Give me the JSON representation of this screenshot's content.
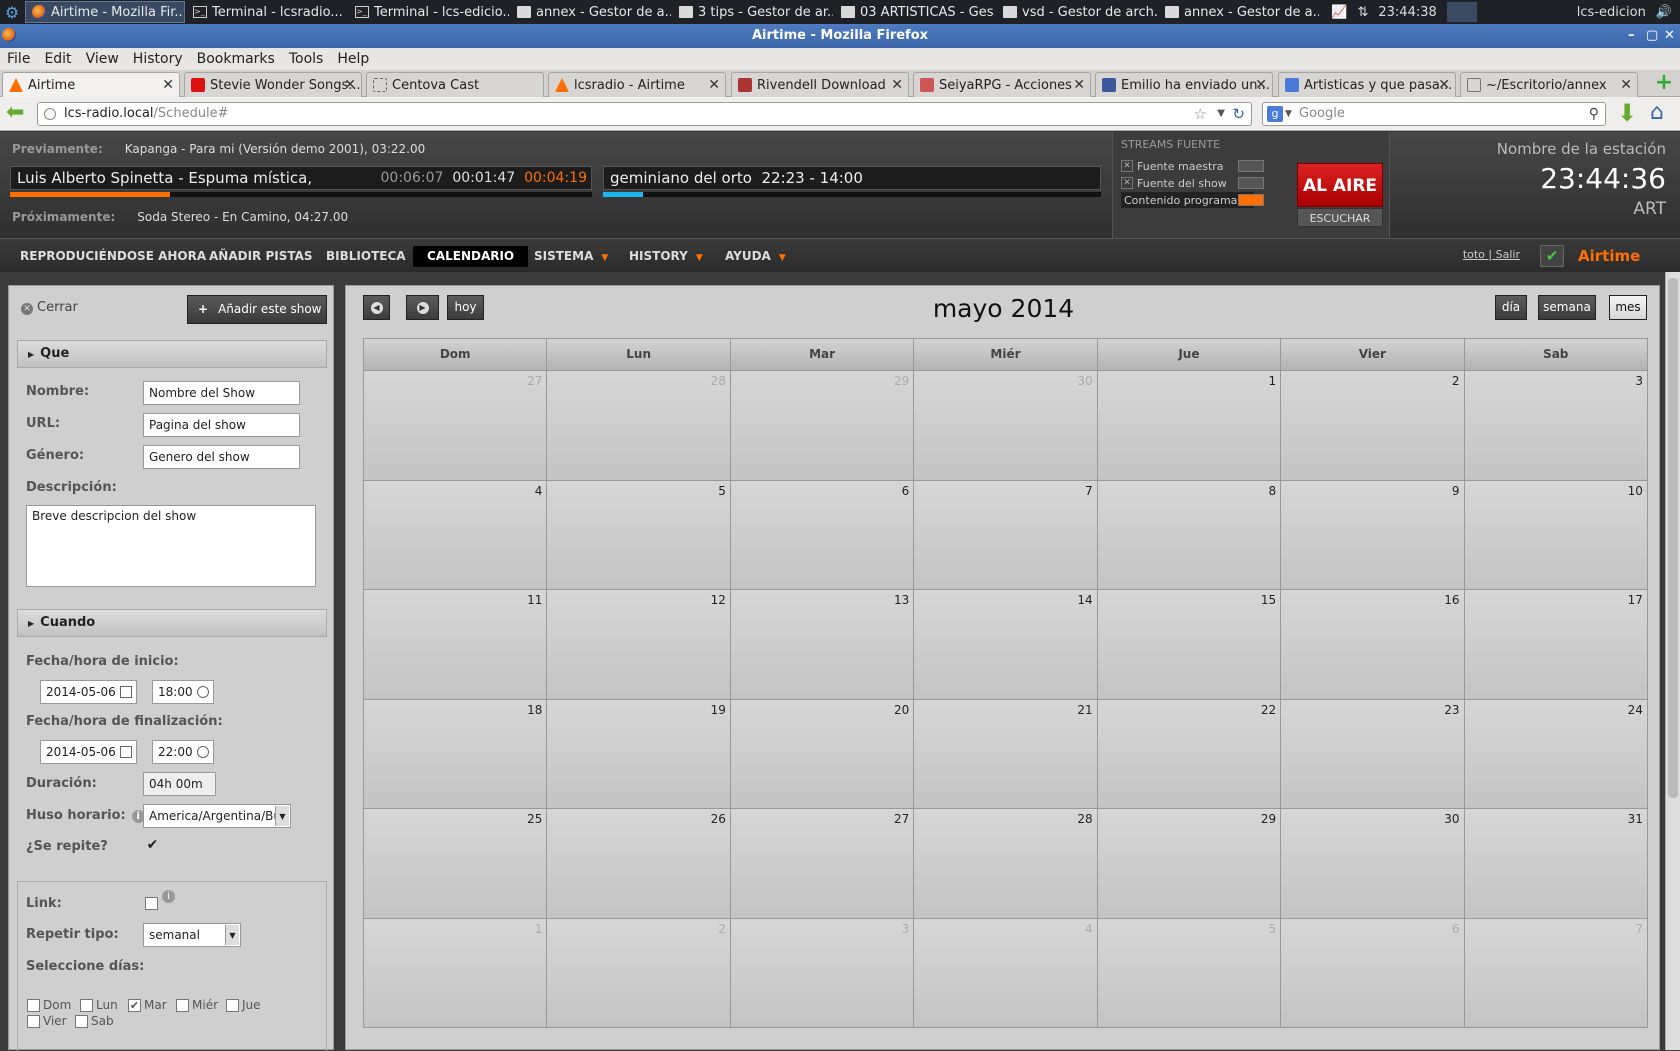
{
  "taskbar": {
    "tasks": [
      "Airtime - Mozilla Fir...",
      "Terminal - lcsradio...",
      "Terminal - lcs-edicio...",
      "annex - Gestor de a...",
      "3 tips - Gestor de ar...",
      "03 ARTISTICAS - Ges...",
      "vsd - Gestor de arch...",
      "annex - Gestor de a..."
    ],
    "clock": "23:44:38",
    "user": "lcs-edicion"
  },
  "window": {
    "title": "Airtime - Mozilla Firefox"
  },
  "menu": [
    "File",
    "Edit",
    "View",
    "History",
    "Bookmarks",
    "Tools",
    "Help"
  ],
  "tabs": [
    "Airtime",
    "Stevie Wonder Songs...",
    "Centova Cast",
    "lcsradio - Airtime",
    "Rivendell Download",
    "SeiyaRPG - Acciones",
    "Emilio ha enviado un...",
    "Artisticas y que pasa...",
    "~/Escritorio/annex"
  ],
  "nav": {
    "url_host": "lcs-radio.local",
    "url_path": "/Schedule#",
    "search_placeholder": "Google"
  },
  "player": {
    "prev_label": "Previamente:",
    "prev_value": "Kapanga - Para mi (Versión demo 2001), 03:22.00",
    "current_track": "Luis Alberto Spinetta - Espuma mística,",
    "elapsed": "00:06:07",
    "middle": "00:01:47",
    "remaining": "00:04:19",
    "track_progress": 0.275,
    "current_show": "geminiano del orto",
    "show_time": "22:23 - 14:00",
    "show_progress": 0.08,
    "next_label": "Próximamente:",
    "next_value": "Soda Stereo - En Camino, 04:27.00"
  },
  "streams": {
    "title": "STREAMS FUENTE",
    "master": "Fuente maestra",
    "show": "Fuente del show",
    "scheduled": "Contenido programado",
    "on_air": "AL AIRE",
    "listen": "ESCUCHAR"
  },
  "station": {
    "name": "Nombre de la estación",
    "clock": "23:44:36",
    "tz": "ART"
  },
  "mainnav": {
    "items": [
      "REPRODUCIÉNDOSE AHORA",
      "AÑADIR PISTAS",
      "BIBLIOTECA",
      "CALENDARIO",
      "SISTEMA",
      "HISTORY",
      "AYUDA"
    ],
    "user": "toto",
    "sep": "|",
    "logout": "Salir",
    "logo": "Airtime"
  },
  "form": {
    "close": "Cerrar",
    "add_show": "Añadir este show",
    "what_section": "Que",
    "name_label": "Nombre:",
    "name_value": "Nombre del Show",
    "url_label": "URL:",
    "url_value": "Pagina del show",
    "genre_label": "Género:",
    "genre_value": "Genero del show",
    "desc_label": "Descripción:",
    "desc_value": "Breve descripcion del show",
    "when_section": "Cuando",
    "start_label": "Fecha/hora de inicio:",
    "start_date": "2014-05-06",
    "start_time": "18:00",
    "end_label": "Fecha/hora de finalización:",
    "end_date": "2014-05-06",
    "end_time": "22:00",
    "duration_label": "Duración:",
    "duration_value": "04h 00m",
    "tz_label": "Huso horario:",
    "tz_value": "America/Argentina/Bue",
    "repeat_label": "¿Se repite?",
    "link_label": "Link:",
    "repeat_type_label": "Repetir tipo:",
    "repeat_type_value": "semanal",
    "days_label": "Seleccione días:",
    "days": [
      "Dom",
      "Lun",
      "Mar",
      "Miér",
      "Jue",
      "Vier",
      "Sab"
    ]
  },
  "calendar": {
    "today_btn": "hoy",
    "view_day": "día",
    "view_week": "semana",
    "view_month": "mes",
    "title": "mayo 2014",
    "weekdays": [
      "Dom",
      "Lun",
      "Mar",
      "Miér",
      "Jue",
      "Vier",
      "Sab"
    ],
    "weeks": [
      [
        "27",
        "28",
        "29",
        "30",
        "1",
        "2",
        "3"
      ],
      [
        "4",
        "5",
        "6",
        "7",
        "8",
        "9",
        "10"
      ],
      [
        "11",
        "12",
        "13",
        "14",
        "15",
        "16",
        "17"
      ],
      [
        "18",
        "19",
        "20",
        "21",
        "22",
        "23",
        "24"
      ],
      [
        "25",
        "26",
        "27",
        "28",
        "29",
        "30",
        "31"
      ],
      [
        "1",
        "2",
        "3",
        "4",
        "5",
        "6",
        "7"
      ]
    ]
  }
}
